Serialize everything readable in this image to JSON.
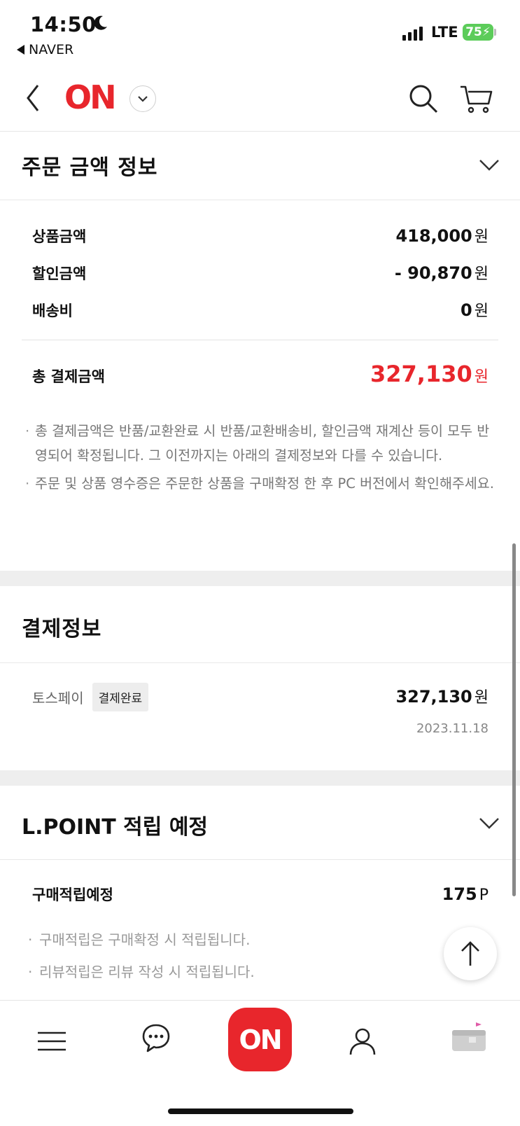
{
  "status_bar": {
    "time": "14:50",
    "back_app": "NAVER",
    "network": "LTE",
    "battery": "75"
  },
  "header": {
    "logo": "ON",
    "icons": [
      "back-icon",
      "chevron-down-icon",
      "search-icon",
      "cart-icon"
    ]
  },
  "order_amount": {
    "title": "주문 금액 정보",
    "rows": [
      {
        "label": "상품금액",
        "value": "418,000",
        "unit": "원"
      },
      {
        "label": "할인금액",
        "value": "- 90,870",
        "unit": "원"
      },
      {
        "label": "배송비",
        "value": "0",
        "unit": "원"
      }
    ],
    "total_label": "총 결제금액",
    "total_value": "327,130",
    "total_unit": "원",
    "notes": [
      "총 결제금액은 반품/교환완료 시 반품/교환배송비, 할인금액 재계산 등이 모두 반영되어 확정됩니다. 그 이전까지는 아래의 결제정보와 다를 수 있습니다.",
      "주문 및 상품 영수증은 주문한 상품을 구매확정 한 후 PC 버전에서 확인해주세요."
    ]
  },
  "payment_info": {
    "title": "결제정보",
    "method": "토스페이",
    "status_badge": "결제완료",
    "amount": "327,130",
    "unit": "원",
    "date": "2023.11.18"
  },
  "lpoint": {
    "title": "L.POINT 적립 예정",
    "row_label": "구매적립예정",
    "row_value": "175",
    "row_unit": "P",
    "notes": [
      "구매적립은 구매확정 시 적립됩니다.",
      "리뷰적립은 리뷰 작성 시 적립됩니다."
    ]
  },
  "bottom_nav": {
    "center_label": "ON",
    "items": [
      "menu-icon",
      "chat-icon",
      "on-home-button",
      "my-page-icon",
      "recent-item-thumbnail"
    ]
  },
  "colors": {
    "brand_red": "#e8262c",
    "battery_green": "#5ccc5a"
  }
}
